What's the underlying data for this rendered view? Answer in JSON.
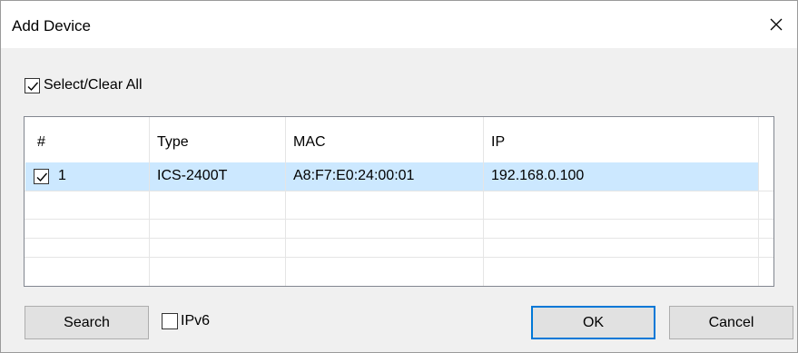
{
  "window": {
    "title": "Add Device"
  },
  "select_all": {
    "label": "Select/Clear All",
    "checked": true
  },
  "table": {
    "columns": [
      "#",
      "Type",
      "MAC",
      "IP"
    ],
    "rows": [
      {
        "checked": true,
        "num": "1",
        "type": "ICS-2400T",
        "mac": "A8:F7:E0:24:00:01",
        "ip": "192.168.0.100"
      }
    ]
  },
  "buttons": {
    "search": "Search",
    "ok": "OK",
    "cancel": "Cancel"
  },
  "ipv6": {
    "label": "IPv6",
    "checked": false
  },
  "colors": {
    "selection": "#cce8ff",
    "default_button_border": "#0078d7",
    "dialog_bg": "#f0f0f0"
  }
}
